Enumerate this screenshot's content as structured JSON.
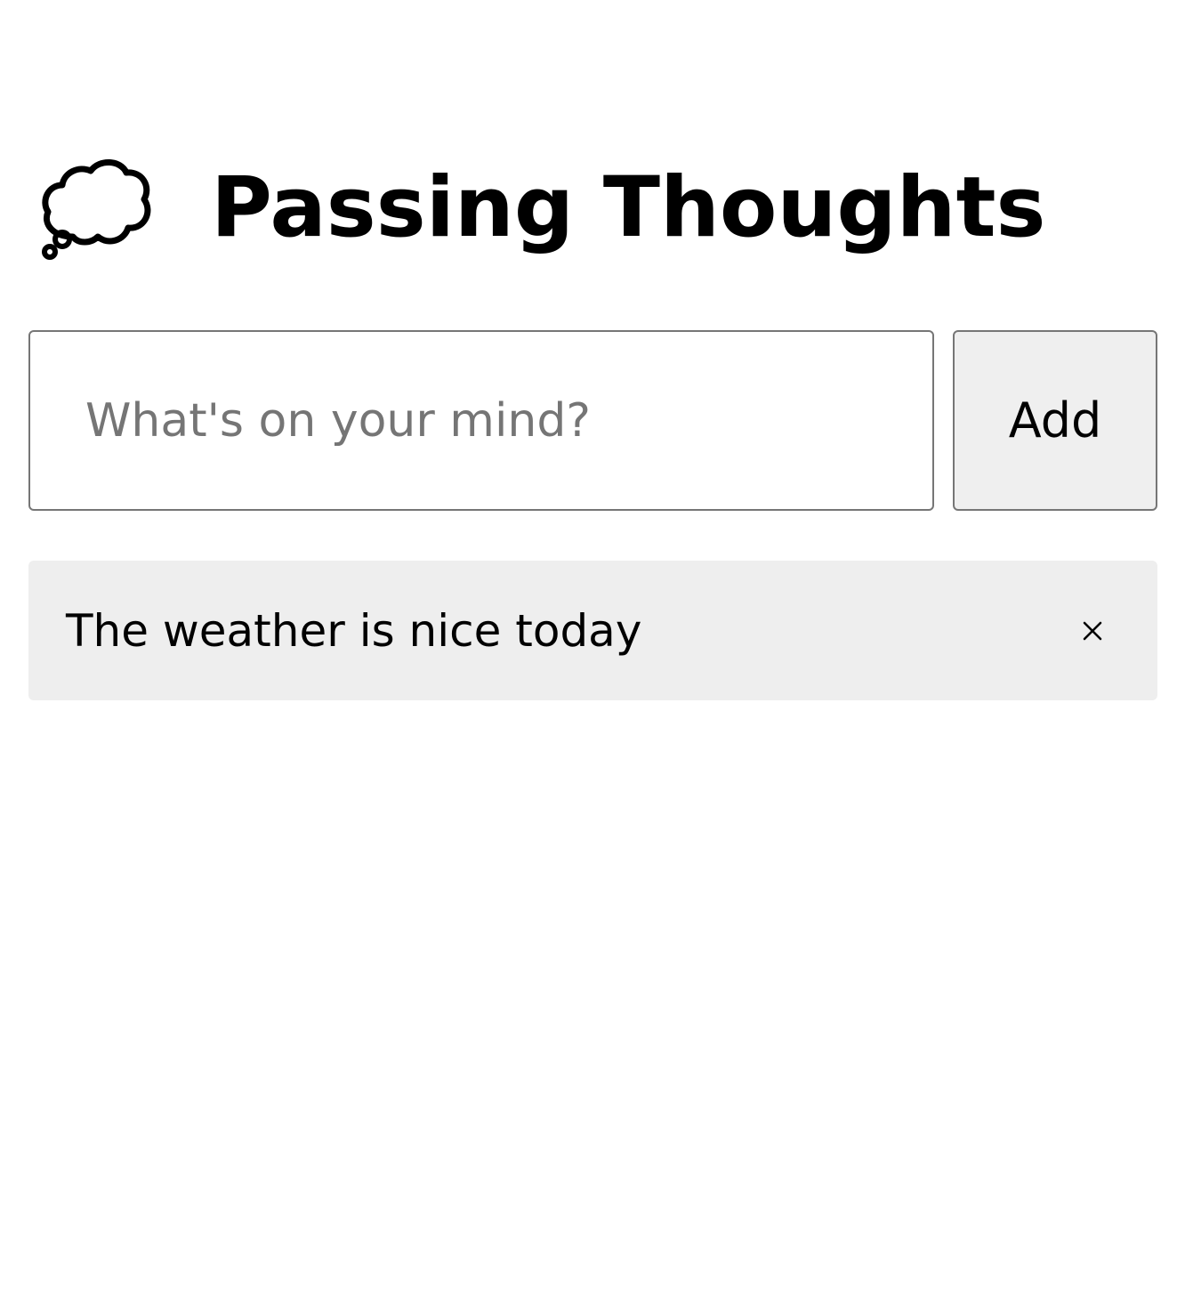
{
  "header": {
    "icon": "thought-balloon-icon",
    "title": "Passing Thoughts"
  },
  "composer": {
    "placeholder": "What's on your mind?",
    "value": "",
    "add_label": "Add"
  },
  "thoughts": [
    {
      "text": "The weather is nice today",
      "delete_icon": "close-icon"
    }
  ],
  "colors": {
    "input_border": "#767676",
    "placeholder": "#757575",
    "button_background": "#efefef",
    "item_background": "#eeeeee"
  }
}
